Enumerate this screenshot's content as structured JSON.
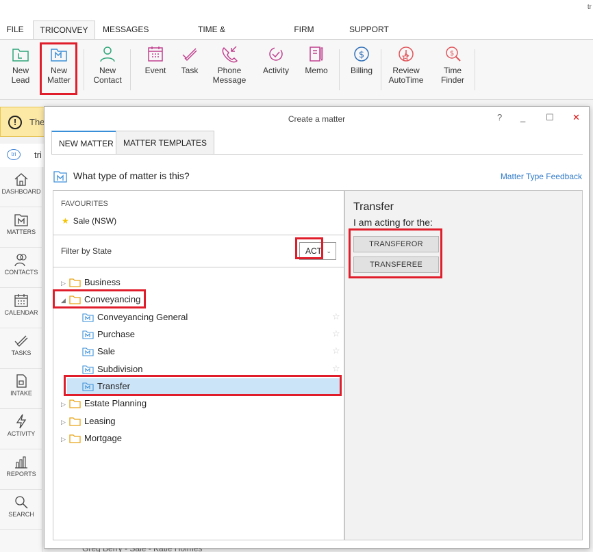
{
  "topbar": {
    "user_hint": "tr"
  },
  "menubar": {
    "items": [
      "FILE",
      "TRICONVEY",
      "MESSAGES",
      "TIME & DISBURSEMENTS",
      "FIRM INSIGHTS",
      "SUPPORT"
    ],
    "active_index": 1
  },
  "ribbon": {
    "buttons": [
      {
        "label1": "New",
        "label2": "Lead",
        "icon": "new-lead-icon"
      },
      {
        "label1": "New",
        "label2": "Matter",
        "icon": "new-matter-icon"
      },
      {
        "label1": "New",
        "label2": "Contact",
        "icon": "new-contact-icon"
      },
      {
        "label1": "Event",
        "label2": "",
        "icon": "event-icon"
      },
      {
        "label1": "Task",
        "label2": "",
        "icon": "task-icon"
      },
      {
        "label1": "Phone",
        "label2": "Message",
        "icon": "phone-message-icon"
      },
      {
        "label1": "Activity",
        "label2": "",
        "icon": "activity-icon"
      },
      {
        "label1": "Memo",
        "label2": "",
        "icon": "memo-icon"
      },
      {
        "label1": "Billing",
        "label2": "",
        "icon": "billing-icon"
      },
      {
        "label1": "Review",
        "label2": "AutoTime",
        "icon": "review-autotime-icon"
      },
      {
        "label1": "Time",
        "label2": "Finder",
        "icon": "time-finder-icon"
      }
    ]
  },
  "background": {
    "warning_text": "The",
    "logo_text": "tri",
    "bottom_peek": "Greg Berry - Sale - Katie Holmes"
  },
  "sidebar": {
    "items": [
      "DASHBOARD",
      "MATTERS",
      "CONTACTS",
      "CALENDAR",
      "TASKS",
      "INTAKE",
      "ACTIVITY",
      "REPORTS",
      "SEARCH"
    ]
  },
  "dialog": {
    "title": "Create a matter",
    "help": "?",
    "minimize": "_",
    "maximize": "☐",
    "close": "✕",
    "tabs": [
      "NEW MATTER",
      "MATTER TEMPLATES"
    ],
    "question": "What type of matter is this?",
    "feedback_link": "Matter Type Feedback",
    "favourites_heading": "FAVOURITES",
    "favourite_item": "Sale (NSW)",
    "filter_label": "Filter by State",
    "state_value": "ACT",
    "tree": {
      "business": "Business",
      "conveyancing": "Conveyancing",
      "children": [
        "Conveyancing General",
        "Purchase",
        "Sale",
        "Subdivision",
        "Transfer"
      ],
      "estate_planning": "Estate Planning",
      "leasing": "Leasing",
      "mortgage": "Mortgage"
    },
    "right_panel": {
      "title": "Transfer",
      "subtitle": "I am acting for the:",
      "btn_transferor": "TRANSFEROR",
      "btn_transferee": "TRANSFEREE"
    }
  },
  "colors": {
    "accent": "#3a8fd9",
    "highlight": "#e01e2b",
    "selected": "#cce4f7",
    "ribbon_icon": "#2fa57a"
  }
}
